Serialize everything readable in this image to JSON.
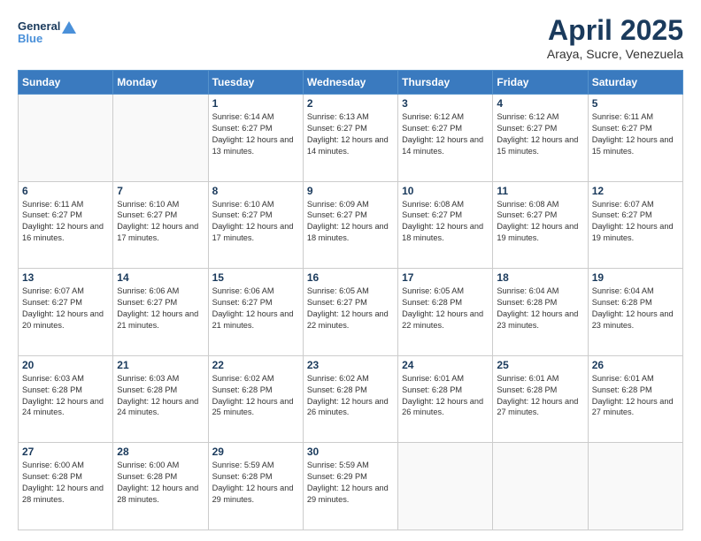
{
  "header": {
    "logo_line1": "General",
    "logo_line2": "Blue",
    "month_title": "April 2025",
    "subtitle": "Araya, Sucre, Venezuela"
  },
  "days_of_week": [
    "Sunday",
    "Monday",
    "Tuesday",
    "Wednesday",
    "Thursday",
    "Friday",
    "Saturday"
  ],
  "weeks": [
    [
      {
        "day": "",
        "empty": true
      },
      {
        "day": "",
        "empty": true
      },
      {
        "day": "1",
        "sunrise": "6:14 AM",
        "sunset": "6:27 PM",
        "daylight": "12 hours and 13 minutes."
      },
      {
        "day": "2",
        "sunrise": "6:13 AM",
        "sunset": "6:27 PM",
        "daylight": "12 hours and 14 minutes."
      },
      {
        "day": "3",
        "sunrise": "6:12 AM",
        "sunset": "6:27 PM",
        "daylight": "12 hours and 14 minutes."
      },
      {
        "day": "4",
        "sunrise": "6:12 AM",
        "sunset": "6:27 PM",
        "daylight": "12 hours and 15 minutes."
      },
      {
        "day": "5",
        "sunrise": "6:11 AM",
        "sunset": "6:27 PM",
        "daylight": "12 hours and 15 minutes."
      }
    ],
    [
      {
        "day": "6",
        "sunrise": "6:11 AM",
        "sunset": "6:27 PM",
        "daylight": "12 hours and 16 minutes."
      },
      {
        "day": "7",
        "sunrise": "6:10 AM",
        "sunset": "6:27 PM",
        "daylight": "12 hours and 17 minutes."
      },
      {
        "day": "8",
        "sunrise": "6:10 AM",
        "sunset": "6:27 PM",
        "daylight": "12 hours and 17 minutes."
      },
      {
        "day": "9",
        "sunrise": "6:09 AM",
        "sunset": "6:27 PM",
        "daylight": "12 hours and 18 minutes."
      },
      {
        "day": "10",
        "sunrise": "6:08 AM",
        "sunset": "6:27 PM",
        "daylight": "12 hours and 18 minutes."
      },
      {
        "day": "11",
        "sunrise": "6:08 AM",
        "sunset": "6:27 PM",
        "daylight": "12 hours and 19 minutes."
      },
      {
        "day": "12",
        "sunrise": "6:07 AM",
        "sunset": "6:27 PM",
        "daylight": "12 hours and 19 minutes."
      }
    ],
    [
      {
        "day": "13",
        "sunrise": "6:07 AM",
        "sunset": "6:27 PM",
        "daylight": "12 hours and 20 minutes."
      },
      {
        "day": "14",
        "sunrise": "6:06 AM",
        "sunset": "6:27 PM",
        "daylight": "12 hours and 21 minutes."
      },
      {
        "day": "15",
        "sunrise": "6:06 AM",
        "sunset": "6:27 PM",
        "daylight": "12 hours and 21 minutes."
      },
      {
        "day": "16",
        "sunrise": "6:05 AM",
        "sunset": "6:27 PM",
        "daylight": "12 hours and 22 minutes."
      },
      {
        "day": "17",
        "sunrise": "6:05 AM",
        "sunset": "6:28 PM",
        "daylight": "12 hours and 22 minutes."
      },
      {
        "day": "18",
        "sunrise": "6:04 AM",
        "sunset": "6:28 PM",
        "daylight": "12 hours and 23 minutes."
      },
      {
        "day": "19",
        "sunrise": "6:04 AM",
        "sunset": "6:28 PM",
        "daylight": "12 hours and 23 minutes."
      }
    ],
    [
      {
        "day": "20",
        "sunrise": "6:03 AM",
        "sunset": "6:28 PM",
        "daylight": "12 hours and 24 minutes."
      },
      {
        "day": "21",
        "sunrise": "6:03 AM",
        "sunset": "6:28 PM",
        "daylight": "12 hours and 24 minutes."
      },
      {
        "day": "22",
        "sunrise": "6:02 AM",
        "sunset": "6:28 PM",
        "daylight": "12 hours and 25 minutes."
      },
      {
        "day": "23",
        "sunrise": "6:02 AM",
        "sunset": "6:28 PM",
        "daylight": "12 hours and 26 minutes."
      },
      {
        "day": "24",
        "sunrise": "6:01 AM",
        "sunset": "6:28 PM",
        "daylight": "12 hours and 26 minutes."
      },
      {
        "day": "25",
        "sunrise": "6:01 AM",
        "sunset": "6:28 PM",
        "daylight": "12 hours and 27 minutes."
      },
      {
        "day": "26",
        "sunrise": "6:01 AM",
        "sunset": "6:28 PM",
        "daylight": "12 hours and 27 minutes."
      }
    ],
    [
      {
        "day": "27",
        "sunrise": "6:00 AM",
        "sunset": "6:28 PM",
        "daylight": "12 hours and 28 minutes."
      },
      {
        "day": "28",
        "sunrise": "6:00 AM",
        "sunset": "6:28 PM",
        "daylight": "12 hours and 28 minutes."
      },
      {
        "day": "29",
        "sunrise": "5:59 AM",
        "sunset": "6:28 PM",
        "daylight": "12 hours and 29 minutes."
      },
      {
        "day": "30",
        "sunrise": "5:59 AM",
        "sunset": "6:29 PM",
        "daylight": "12 hours and 29 minutes."
      },
      {
        "day": "",
        "empty": true
      },
      {
        "day": "",
        "empty": true
      },
      {
        "day": "",
        "empty": true
      }
    ]
  ],
  "labels": {
    "sunrise_label": "Sunrise: ",
    "sunset_label": "Sunset: ",
    "daylight_label": "Daylight: "
  }
}
